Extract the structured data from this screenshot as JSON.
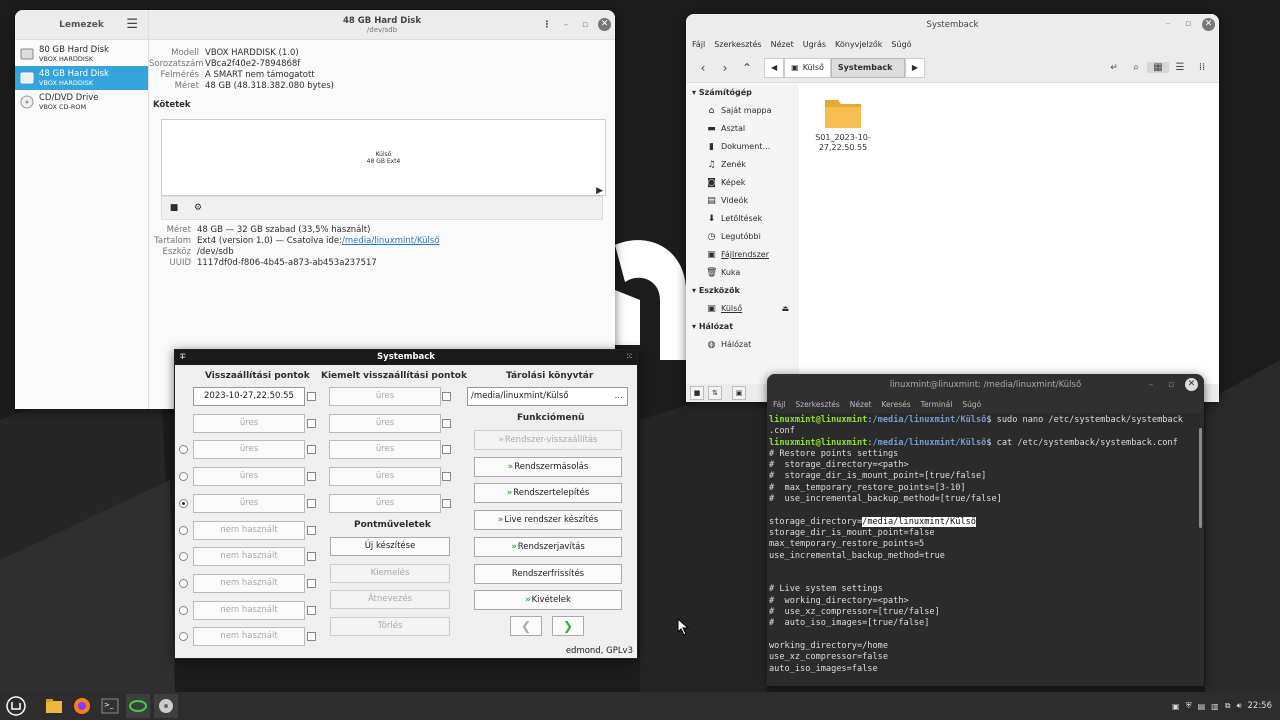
{
  "disks": {
    "sidebar_title": "Lemezek",
    "items": [
      {
        "name": "80 GB Hard Disk",
        "sub": "VBOX HARDDISK"
      },
      {
        "name": "48 GB Hard Disk",
        "sub": "VBOX HARDDISK"
      },
      {
        "name": "CD/DVD Drive",
        "sub": "VBOX CD-ROM"
      }
    ],
    "title": "48 GB Hard Disk",
    "subtitle": "/dev/sdb",
    "info": [
      {
        "k": "Modell",
        "v": "VBOX HARDDISK (1.0)"
      },
      {
        "k": "Sorozatszám",
        "v": "VBca2f40e2-7894868f"
      },
      {
        "k": "Felmérés",
        "v": "A SMART nem támogatott"
      },
      {
        "k": "Méret",
        "v": "48 GB (48.318.382.080 bytes)"
      }
    ],
    "volumes_label": "Kötetek",
    "volume_name": "Külső",
    "volume_desc": "48 GB Ext4",
    "details": [
      {
        "k": "Méret",
        "v": "48 GB — 32 GB szabad (33,5% használt)"
      },
      {
        "k": "Tartalom",
        "v": "Ext4 (version 1.0) — Csatolva ide: ",
        "link": "/media/linuxmint/Külső"
      },
      {
        "k": "Eszköz",
        "v": "/dev/sdb"
      },
      {
        "k": "UUID",
        "v": "1117df0d-f806-4b45-a873-ab453a237517"
      }
    ]
  },
  "files": {
    "title": "Systemback",
    "menu": [
      "Fájl",
      "Szerkesztés",
      "Nézet",
      "Ugrás",
      "Könyvjelzők",
      "Súgó"
    ],
    "path": [
      "Külső",
      "Systemback"
    ],
    "sidebar": {
      "computer": "Számítógép",
      "places": [
        "Saját mappa",
        "Asztal",
        "Dokument…",
        "Zenék",
        "Képek",
        "Videók",
        "Letöltések",
        "Legutóbbi",
        "Fájlrendszer",
        "Kuka"
      ],
      "devices": "Eszközök",
      "device_items": [
        "Külső"
      ],
      "network": "Hálózat",
      "network_items": [
        "Hálózat"
      ]
    },
    "folder": [
      "S01_2023-10-",
      "27,22.50.55"
    ],
    "accent": "#f0b53c"
  },
  "terminal": {
    "title": "linuxmint@linuxmint: /media/linuxmint/Külső",
    "menu": [
      "Fájl",
      "Szerkesztés",
      "Nézet",
      "Keresés",
      "Terminál",
      "Súgó"
    ],
    "user": "linuxmint@linuxmint",
    "path": "/media/linuxmint/Külső",
    "cmd1": "$ sudo nano /etc/systemback/systemback",
    "cmd1b": ".conf",
    "cmd2": "$ cat /etc/systemback/systemback.conf",
    "lines_a": [
      "# Restore points settings",
      "#  storage_directory=<path>",
      "#  storage_dir_is_mount_point=[true/false]",
      "#  max_temporary_restore_points=[3-10]",
      "#  use_incremental_backup_method=[true/false]",
      ""
    ],
    "storage_key": "storage_directory=",
    "storage_val": "/media/linuxmint/Külső",
    "lines_b": [
      "storage_dir_is_mount_point=false",
      "max_temporary_restore_points=5",
      "use_incremental_backup_method=true",
      "",
      "",
      "# Live system settings",
      "#  working_directory=<path>",
      "#  use_xz_compressor=[true/false]",
      "#  auto_iso_images=[true/false]",
      "",
      "working_directory=/home",
      "use_xz_compressor=false",
      "auto_iso_images=false"
    ]
  },
  "systemback": {
    "title": "Systemback",
    "col1": "Visszaállítási pontok",
    "col2": "Kiemelt visszaállítási pontok",
    "col3": "Tárolási könyvtár",
    "points": [
      "2023-10-27,22.50.55",
      "üres",
      "üres",
      "üres",
      "üres",
      "nem használt",
      "nem használt",
      "nem használt",
      "nem használt",
      "nem használt"
    ],
    "highlighted": [
      "üres",
      "üres",
      "üres",
      "üres",
      "üres"
    ],
    "storage_path": "/media/linuxmint/Külső",
    "browse": "…",
    "func_title": "Funkciómenü",
    "functions": [
      "Rendszer-visszaállítás",
      "Rendszermásolás",
      "Rendszertelepítés",
      "Live rendszer készítés",
      "Rendszerjavítás",
      "Rendszerfrissítés",
      "Kivételek"
    ],
    "ops_title": "Pontműveletek",
    "ops": [
      "Új készítése",
      "Kiemelés",
      "Átnevezés",
      "Törlés"
    ],
    "footer": "edmond, GPLv3"
  },
  "taskbar": {
    "clock": "22:56"
  }
}
